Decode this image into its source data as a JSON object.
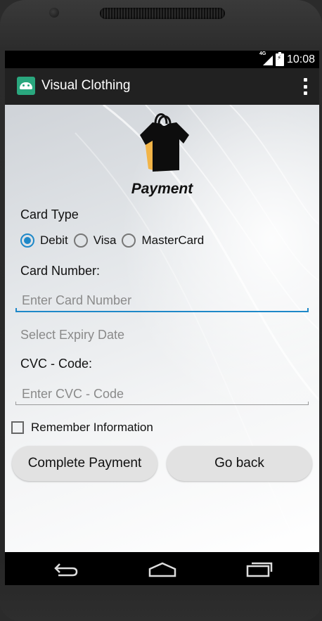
{
  "status_bar": {
    "network": "4G",
    "time": "10:08"
  },
  "app_bar": {
    "title": "Visual Clothing"
  },
  "payment": {
    "title": "Payment",
    "card_type_label": "Card Type",
    "card_types": [
      {
        "label": "Debit",
        "selected": true
      },
      {
        "label": "Visa",
        "selected": false
      },
      {
        "label": "MasterCard",
        "selected": false
      }
    ],
    "card_number_label": "Card Number:",
    "card_number_placeholder": "Enter Card Number",
    "expiry_label": "Select Expiry Date",
    "cvc_label": "CVC - Code:",
    "cvc_placeholder": "Enter CVC - Code",
    "remember_label": "Remember Information",
    "remember_checked": false,
    "complete_button": "Complete Payment",
    "back_button": "Go back"
  },
  "colors": {
    "accent": "#1e88c8",
    "app_bar": "#212121",
    "button": "#e2e2e2"
  },
  "icons": [
    "android-app-icon",
    "overflow-menu-icon",
    "tshirt-bag-logo",
    "back-nav-icon",
    "home-nav-icon",
    "recents-nav-icon"
  ]
}
